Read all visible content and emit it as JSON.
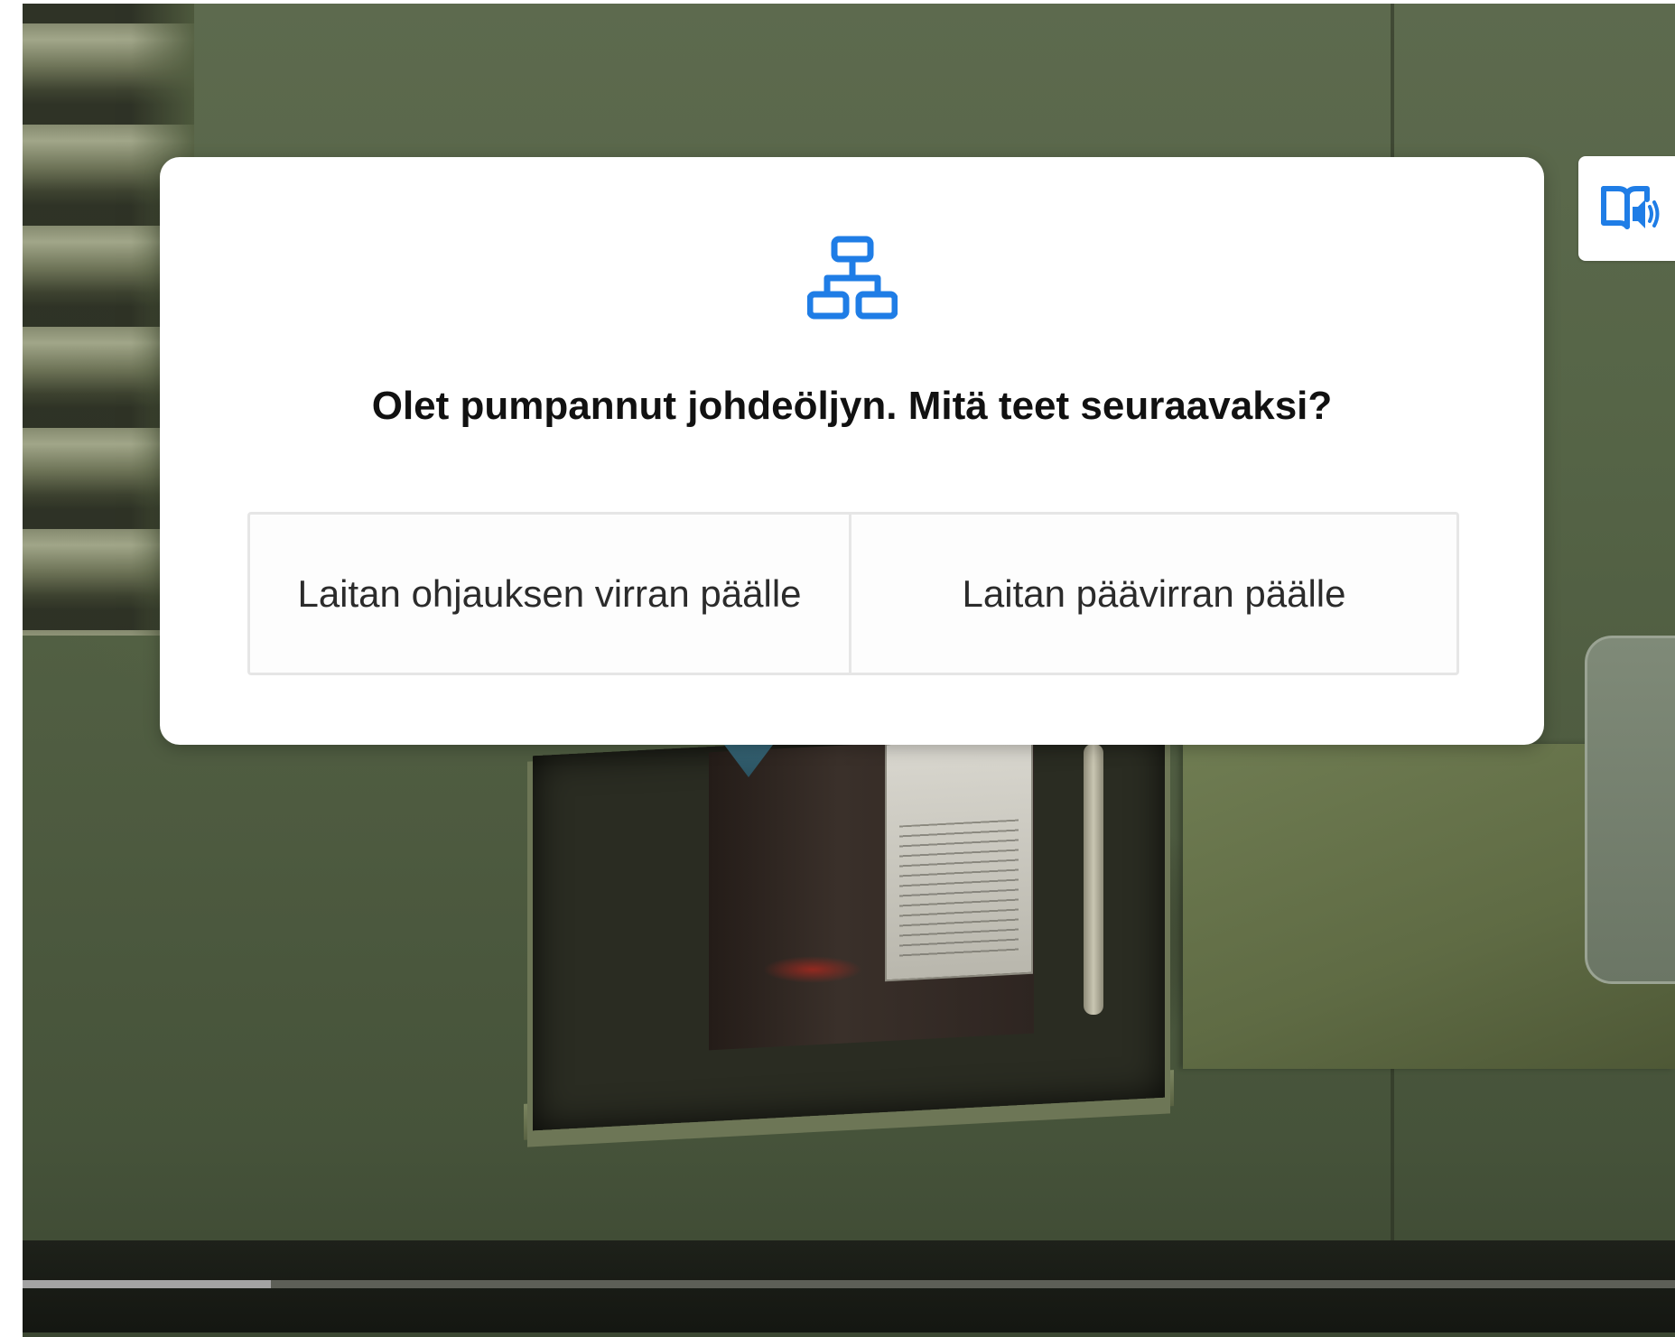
{
  "question_dialog": {
    "icon": "flowchart-branch-icon",
    "question": "Olet pumpannut johdeöljyn. Mitä teet seuraavaksi?",
    "options": [
      {
        "label": "Laitan ohjauksen virran päälle"
      },
      {
        "label": "Laitan päävirran päälle"
      }
    ]
  },
  "narration_button": {
    "icon": "book-audio-icon"
  },
  "video": {
    "progress_fraction": 0.15
  },
  "colors": {
    "accent": "#1f7de6",
    "dialog_background": "#ffffff",
    "question_text": "#111111",
    "option_text": "#2b2b2b",
    "option_border": "#e6e6e6",
    "progress_fill": "#a3a3a3",
    "progress_track": "#6e7068"
  }
}
